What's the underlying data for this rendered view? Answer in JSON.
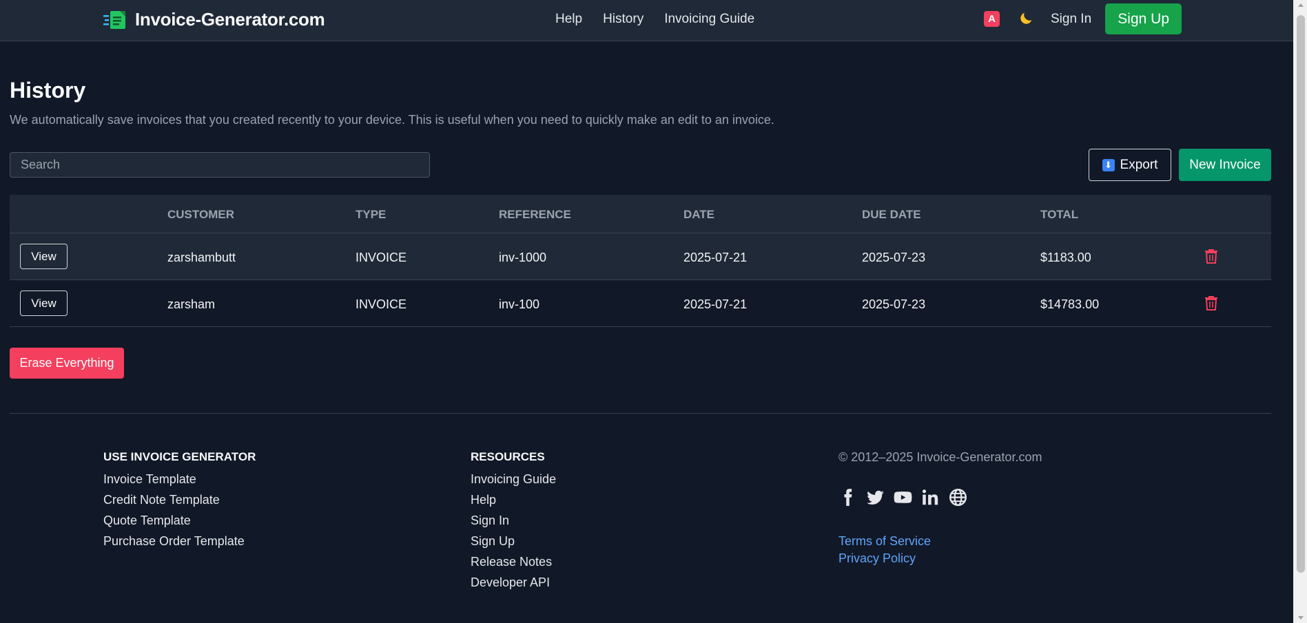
{
  "header": {
    "brand": "Invoice-Generator.com",
    "nav": [
      "Help",
      "History",
      "Invoicing Guide"
    ],
    "lang_badge": "A",
    "signin": "Sign In",
    "signup": "Sign Up"
  },
  "main": {
    "title": "History",
    "description": "We automatically save invoices that you created recently to your device. This is useful when you need to quickly make an edit to an invoice.",
    "search_placeholder": "Search",
    "export_label": "Export",
    "new_invoice_label": "New Invoice",
    "erase_label": "Erase Everything"
  },
  "table": {
    "columns": [
      "CUSTOMER",
      "TYPE",
      "REFERENCE",
      "DATE",
      "DUE DATE",
      "TOTAL"
    ],
    "rows": [
      {
        "view": "View",
        "customer": "zarshambutt",
        "type": "INVOICE",
        "reference": "inv-1000",
        "date": "2025-07-21",
        "due_date": "2025-07-23",
        "total": "$1183.00"
      },
      {
        "view": "View",
        "customer": "zarsham",
        "type": "INVOICE",
        "reference": "inv-100",
        "date": "2025-07-21",
        "due_date": "2025-07-23",
        "total": "$14783.00"
      }
    ]
  },
  "footer": {
    "col1": {
      "heading": "USE INVOICE GENERATOR",
      "links": [
        "Invoice Template",
        "Credit Note Template",
        "Quote Template",
        "Purchase Order Template"
      ]
    },
    "col2": {
      "heading": "RESOURCES",
      "links": [
        "Invoicing Guide",
        "Help",
        "Sign In",
        "Sign Up",
        "Release Notes",
        "Developer API"
      ]
    },
    "copyright": "© 2012–2025 Invoice-Generator.com",
    "socials": [
      "facebook-icon",
      "twitter-icon",
      "youtube-icon",
      "linkedin-icon",
      "globe-icon"
    ],
    "legal": [
      "Terms of Service",
      "Privacy Policy"
    ]
  },
  "colors": {
    "background": "#111827",
    "surface": "#1f2937",
    "accent_green": "#16a34a",
    "new_invoice_green": "#059669",
    "danger": "#f43f5e",
    "link_blue": "#60a5fa"
  }
}
